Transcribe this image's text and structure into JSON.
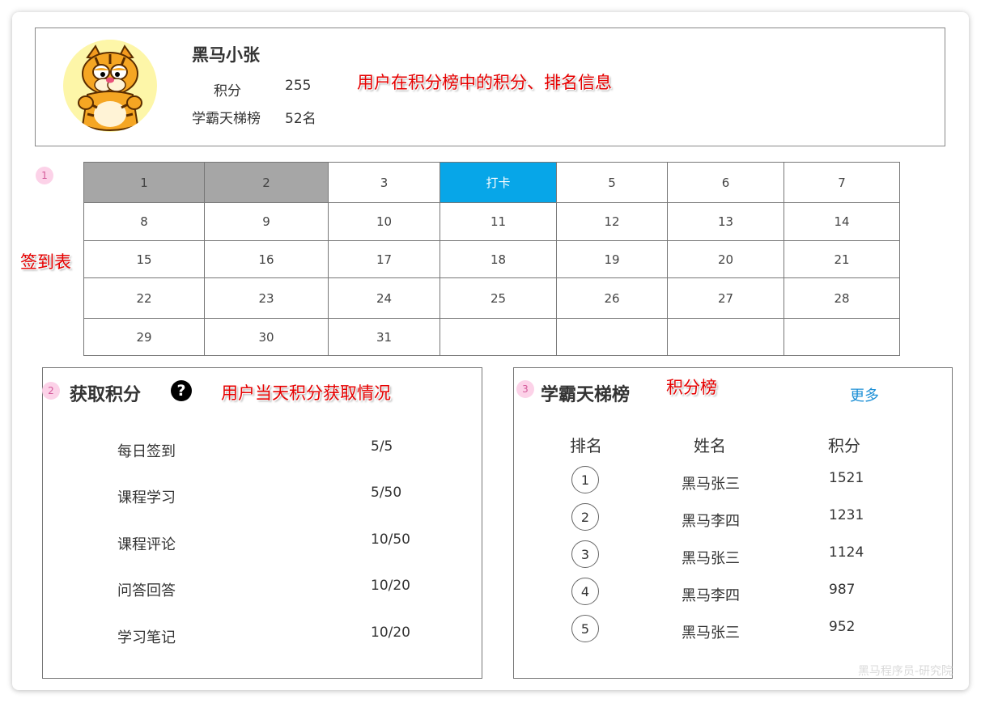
{
  "profile": {
    "username": "黑马小张",
    "points_label": "积分",
    "points_value": "255",
    "rank_label": "学霸天梯榜",
    "rank_value": "52名"
  },
  "annotations": {
    "profile_note": "用户在积分榜中的积分、排名信息",
    "checkin_table": "签到表",
    "earn_note": "用户当天积分获取情况",
    "board_note": "积分榜"
  },
  "badges": {
    "one": "1",
    "two": "2",
    "three": "3"
  },
  "calendar": {
    "rows": [
      [
        "1",
        "2",
        "3",
        "打卡",
        "5",
        "6",
        "7"
      ],
      [
        "8",
        "9",
        "10",
        "11",
        "12",
        "13",
        "14"
      ],
      [
        "15",
        "16",
        "17",
        "18",
        "19",
        "20",
        "21"
      ],
      [
        "22",
        "23",
        "24",
        "25",
        "26",
        "27",
        "28"
      ],
      [
        "29",
        "30",
        "31",
        "",
        "",
        "",
        ""
      ]
    ],
    "past_days": [
      "1",
      "2"
    ],
    "today_label": "打卡",
    "colors": {
      "past": "#a6a6a6",
      "today": "#07a6e8"
    }
  },
  "earn": {
    "title": "获取积分",
    "help_icon": "question-circle-icon",
    "items": [
      {
        "name": "每日签到",
        "value": "5/5"
      },
      {
        "name": "课程学习",
        "value": "5/50"
      },
      {
        "name": "课程评论",
        "value": "10/50"
      },
      {
        "name": "问答回答",
        "value": "10/20"
      },
      {
        "name": "学习笔记",
        "value": "10/20"
      }
    ]
  },
  "leaderboard": {
    "title": "学霸天梯榜",
    "more_label": "更多",
    "headers": {
      "rank": "排名",
      "name": "姓名",
      "points": "积分"
    },
    "rows": [
      {
        "rank": "1",
        "name": "黑马张三",
        "points": "1521"
      },
      {
        "rank": "2",
        "name": "黑马李四",
        "points": "1231"
      },
      {
        "rank": "3",
        "name": "黑马张三",
        "points": "1124"
      },
      {
        "rank": "4",
        "name": "黑马李四",
        "points": "987"
      },
      {
        "rank": "5",
        "name": "黑马张三",
        "points": "952"
      }
    ]
  },
  "watermark": "黑马程序员-研究院"
}
